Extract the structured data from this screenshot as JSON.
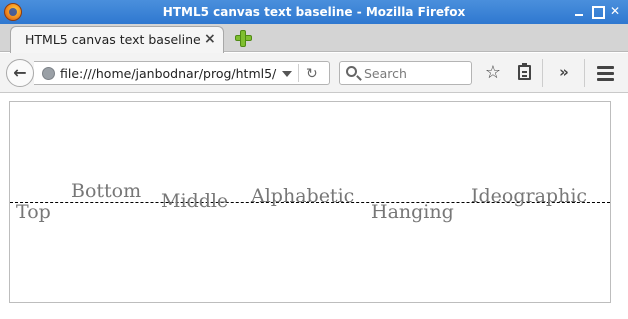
{
  "window": {
    "title": "HTML5 canvas text baseline - Mozilla Firefox"
  },
  "tabs": [
    {
      "label": "HTML5 canvas text baseline",
      "close": "×"
    }
  ],
  "navbar": {
    "back": "←",
    "url": "file:///home/janbodnar/prog/html5/",
    "reload": "↻",
    "search_placeholder": "Search",
    "bookmark": "☆",
    "overflow": "»"
  },
  "canvas": {
    "labels": [
      "Top",
      "Bottom",
      "Middle",
      "Alphabetic",
      "Hanging",
      "Ideographic"
    ],
    "text_color": "#777777",
    "line_color": "#000000"
  }
}
